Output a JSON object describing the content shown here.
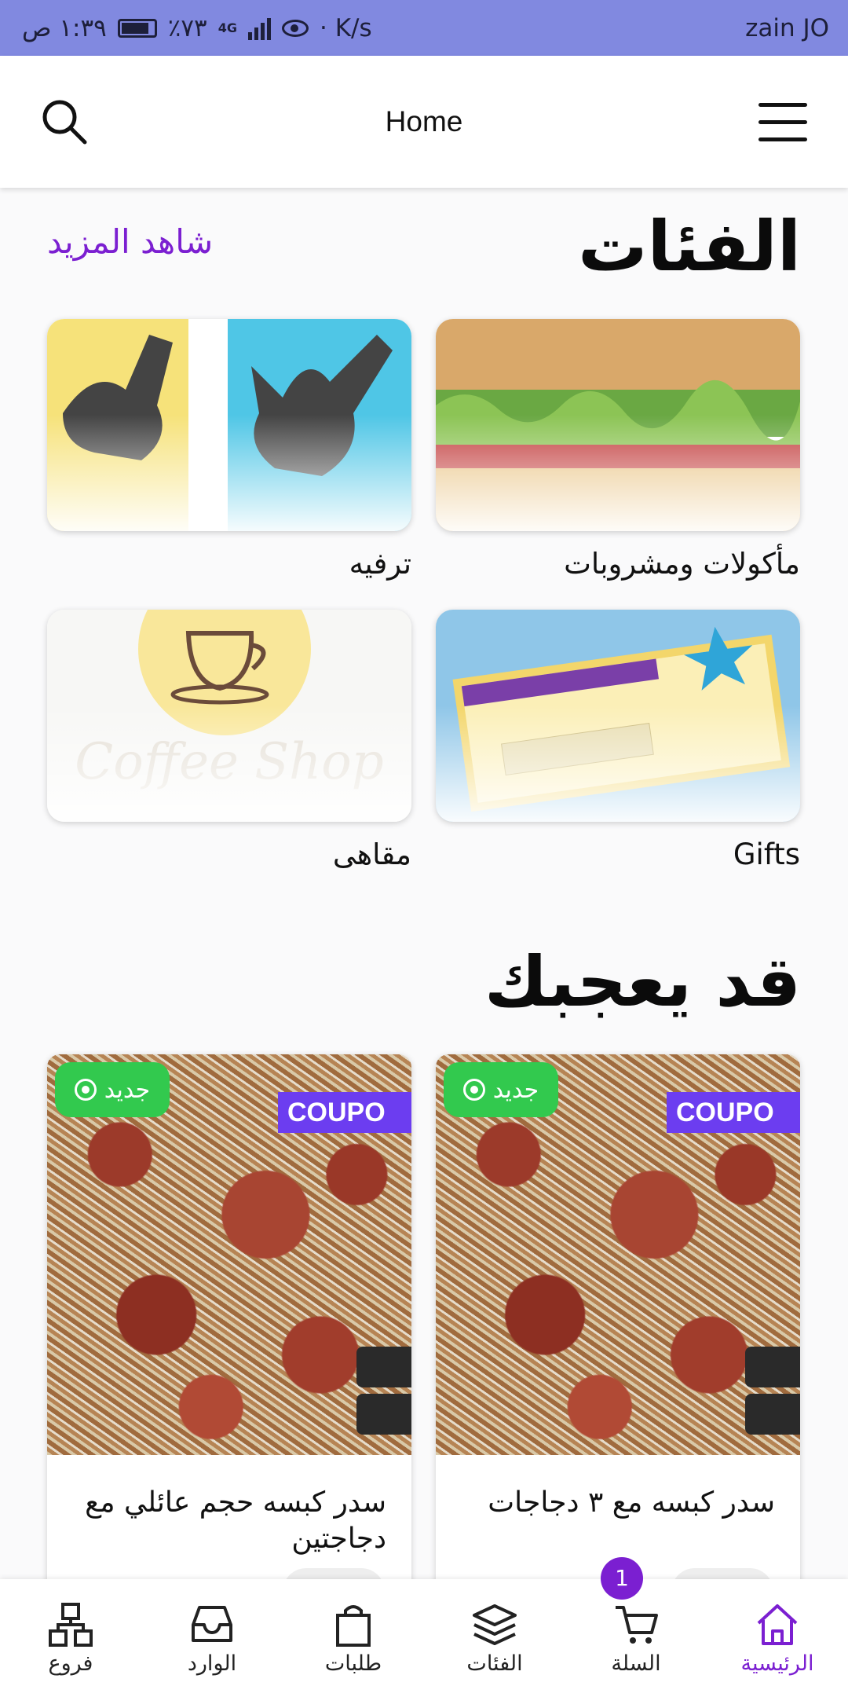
{
  "status_bar": {
    "carrier": "zain JO",
    "speed": "· K/s",
    "network": "4G",
    "battery": "٪٧٣",
    "time": "١:٣٩ ص"
  },
  "app_bar": {
    "title": "Home",
    "search_icon": "search-icon",
    "menu_icon": "hamburger-menu-icon"
  },
  "categories": {
    "title": "الفئات",
    "see_more": "شاهد المزيد",
    "items": [
      {
        "label": "مأكولات ومشروبات",
        "image": "burger-image"
      },
      {
        "label": "ترفيه",
        "image": "jumping-people-image"
      },
      {
        "label": "Gifts",
        "image": "gift-voucher-image"
      },
      {
        "label": "مقاهى",
        "image": "coffee-shop-image"
      }
    ]
  },
  "recommended": {
    "title": "قد يعجبك",
    "products": [
      {
        "name": "سدر كبسه مع ٣ دجاجات",
        "badge": "جديد",
        "banner": "COUPO"
      },
      {
        "name": "سدر كبسه حجم عائلي مع دجاجتين",
        "badge": "جديد",
        "banner": "COUPO"
      }
    ]
  },
  "bottom_nav": {
    "items": [
      {
        "label": "الرئيسية",
        "icon": "home-icon",
        "active": true
      },
      {
        "label": "السلة",
        "icon": "cart-icon"
      },
      {
        "label": "الفئات",
        "icon": "layers-icon"
      },
      {
        "label": "طلبات",
        "icon": "shopping-bag-icon"
      },
      {
        "label": "الوارد",
        "icon": "inbox-icon"
      },
      {
        "label": "فروع",
        "icon": "branches-icon"
      }
    ],
    "cart_count": "1"
  },
  "colors": {
    "status_bar": "#8189e0",
    "accent": "#7b1fd1",
    "badge_green": "#32c94e"
  }
}
